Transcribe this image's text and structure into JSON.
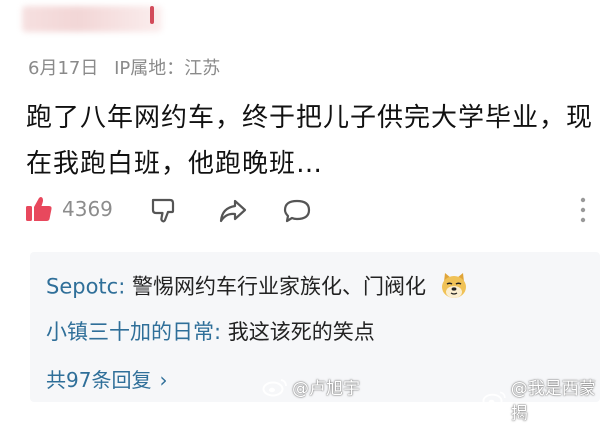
{
  "post": {
    "date": "6月17日",
    "ip_location": "IP属地：江苏",
    "content": "跑了八年网约车，终于把儿子供完大学毕业，现在我跑白班，他跑晚班…"
  },
  "actions": {
    "like_count": "4369"
  },
  "replies": [
    {
      "author": "Sepotc:",
      "text": " 警惕网约车行业家族化、门阀化"
    },
    {
      "author": "小镇三十加的日常:",
      "text": " 我这该死的笑点"
    }
  ],
  "more_replies": {
    "label": "共97条回复",
    "chevron": "›"
  },
  "watermarks": [
    {
      "text": "@卢旭宇"
    },
    {
      "text": "@我是西蒙揭"
    }
  ]
}
